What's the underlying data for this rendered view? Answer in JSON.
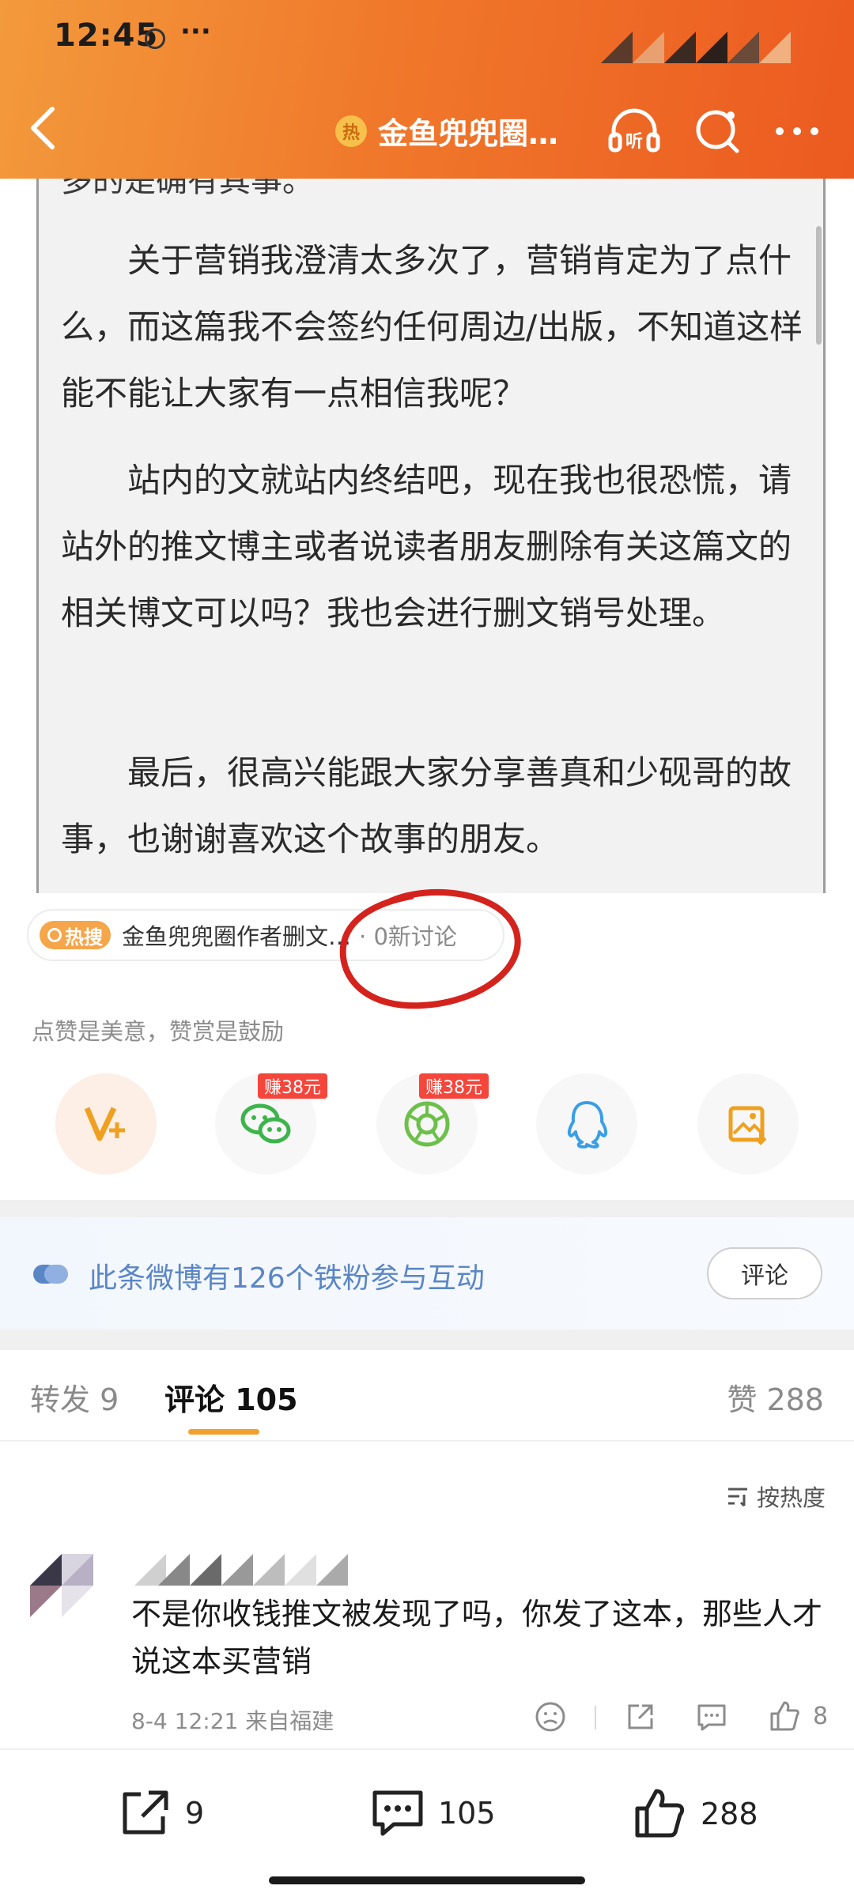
{
  "status_bar": {
    "time": "12:45",
    "more": "···"
  },
  "header": {
    "hot_mark": "热",
    "title": "金鱼兜兜圈…"
  },
  "article": {
    "partial_line": "多的是确有其事。",
    "paragraphs": [
      "关于营销我澄清太多次了，营销肯定为了点什么，而这篇我不会签约任何周边/出版，不知道这样能不能让大家有一点相信我呢？",
      "站内的文就站内终结吧，现在我也很恐慌，请站外的推文博主或者说读者朋友删除有关这篇文的相关博文可以吗？我也会进行删文销号处理。",
      "最后，很高兴能跟大家分享善真和少砚哥的故事，也谢谢喜欢这个故事的朋友。"
    ]
  },
  "trend": {
    "badge": "热搜",
    "topic": "金鱼兜兜圈作者删文…",
    "count": "· 0新讨论"
  },
  "like_hint": "点赞是美意，赞赏是鼓励",
  "share": {
    "earn_label_wechat": "赚38元",
    "earn_label_moments": "赚38元",
    "icons": [
      "vip-plus-icon",
      "wechat-icon",
      "moments-icon",
      "qq-icon",
      "save-image-icon"
    ]
  },
  "fans": {
    "text": "此条微博有126个铁粉参与互动",
    "button": "评论"
  },
  "tabs": {
    "repost": "转发 9",
    "comment": "评论 105",
    "like": "赞 288"
  },
  "sort": {
    "label": "按热度"
  },
  "comment": {
    "text": "不是你收钱推文被发现了吗，你发了这本，那些人才说这本买营销",
    "meta": "8-4 12:21  来自福建",
    "like_count": "8"
  },
  "bottom_bar": {
    "repost_count": "9",
    "comment_count": "105",
    "like_count": "288"
  },
  "colors": {
    "header_orange": "#f0782b",
    "accent_blue": "#5b86c6",
    "tab_underline": "#f0a02e",
    "annotation_red": "#d4231d"
  }
}
